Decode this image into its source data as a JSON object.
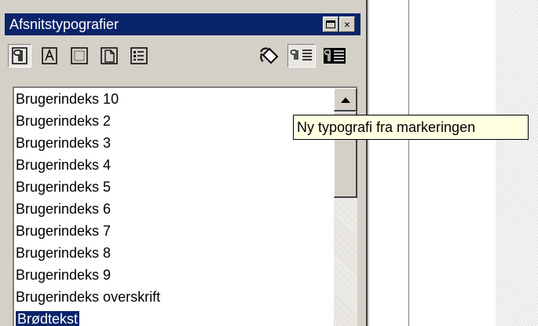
{
  "window": {
    "title": "Afsnitstypografier",
    "minimize_label": "",
    "close_label": "×"
  },
  "toolbar": {
    "buttons": [
      {
        "name": "paragraph-styles",
        "icon": "pilcrow-icon",
        "pressed": true
      },
      {
        "name": "character-styles",
        "icon": "letter-a-icon",
        "pressed": false
      },
      {
        "name": "frame-styles",
        "icon": "frame-icon",
        "pressed": false
      },
      {
        "name": "page-styles",
        "icon": "page-icon",
        "pressed": false
      },
      {
        "name": "list-styles",
        "icon": "list-icon",
        "pressed": false
      },
      {
        "name": "fill-format-mode",
        "icon": "paint-bucket-icon",
        "pressed": false
      },
      {
        "name": "new-style-from-selection",
        "icon": "new-style-icon",
        "pressed": true
      },
      {
        "name": "update-style",
        "icon": "update-style-icon",
        "pressed": false
      }
    ]
  },
  "styles_list": {
    "items": [
      "Brugerindeks 10",
      "Brugerindeks 2",
      "Brugerindeks 3",
      "Brugerindeks 4",
      "Brugerindeks 5",
      "Brugerindeks 6",
      "Brugerindeks 7",
      "Brugerindeks 8",
      "Brugerindeks 9",
      "Brugerindeks overskrift",
      "Brødtekst"
    ],
    "selected": "Brødtekst"
  },
  "tooltip": {
    "text": "Ny typografi fra markeringen"
  },
  "colors": {
    "titlebar": "#0a246a",
    "face": "#d4d0c8",
    "tooltip_bg": "#ffffe1",
    "selection": "#0a246a"
  }
}
